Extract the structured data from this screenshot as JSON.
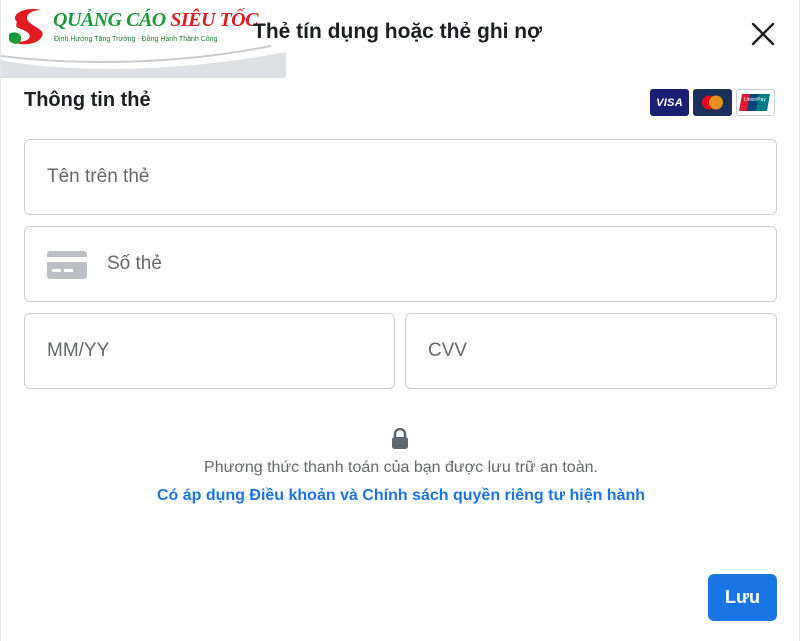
{
  "logo": {
    "brand_part1": "QUẢNG CÁO ",
    "brand_part2": "SIÊU TỐC",
    "tagline": "Định Hướng Tăng Trưởng - Đồng Hành Thành Công"
  },
  "dialog": {
    "title": "Thẻ tín dụng hoặc thẻ ghi nợ",
    "close_icon": "close-icon"
  },
  "card_info": {
    "section_title": "Thông tin thẻ",
    "card_brands": [
      "VISA",
      "Mastercard",
      "UnionPay"
    ],
    "visa_label": "VISA",
    "unionpay_label": "UnionPay"
  },
  "fields": {
    "name_placeholder": "Tên trên thẻ",
    "number_placeholder": "Số thẻ",
    "expiry_placeholder": "MM/YY",
    "cvv_placeholder": "CVV"
  },
  "security": {
    "message": "Phương thức thanh toán của bạn được lưu trữ an toàn.",
    "terms_link": "Có áp dụng Điều khoản và Chính sách quyền riêng tư hiện hành"
  },
  "actions": {
    "save_label": "Lưu"
  },
  "colors": {
    "primary": "#1b74e4",
    "brand_green": "#1a9a3a",
    "brand_red": "#e11b22"
  }
}
